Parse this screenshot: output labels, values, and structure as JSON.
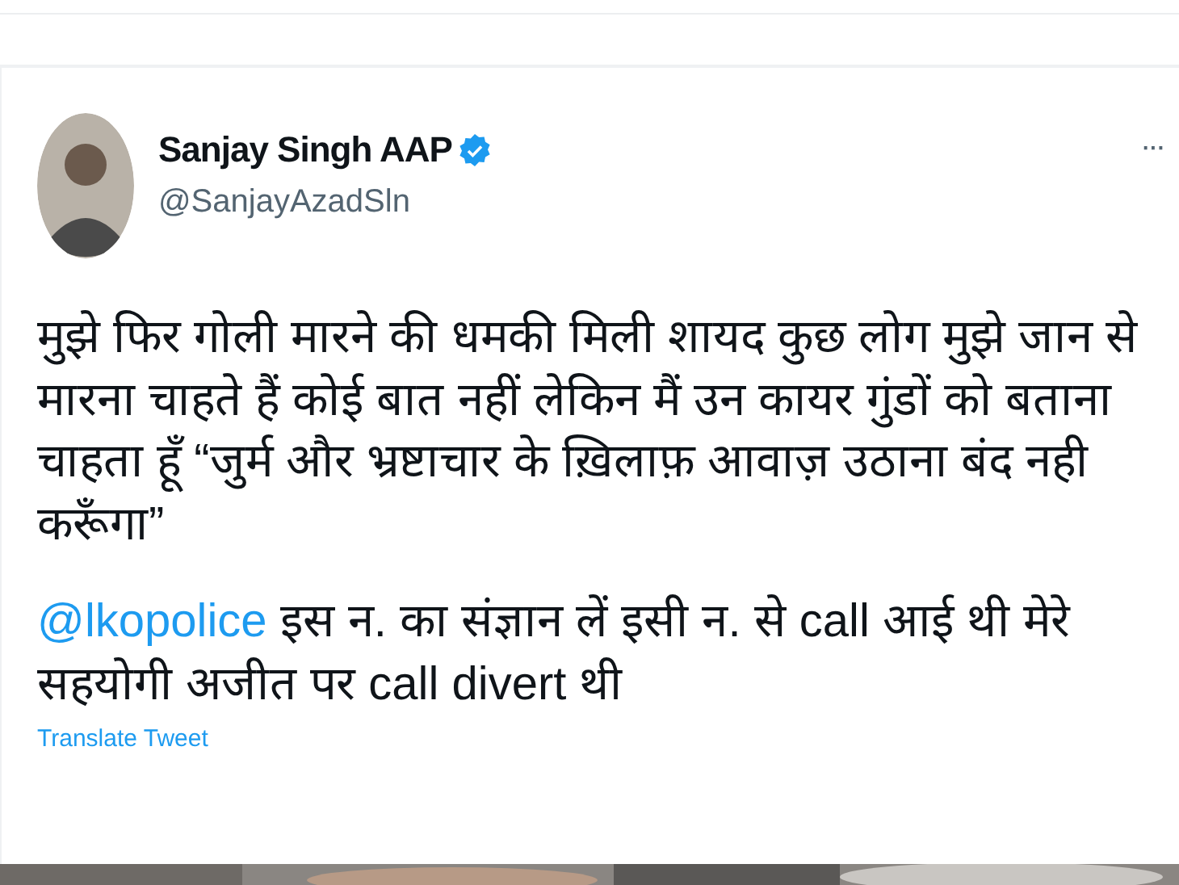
{
  "tweet": {
    "author": {
      "name": "Sanjay Singh AAP",
      "verified": true,
      "handle": "@SanjayAzadSln"
    },
    "more": "···",
    "text": "मुझे फिर गोली मारने की धमकी मिली शायद कुछ लोग मुझे जान से मारना चाहते हैं कोई बात नहीं लेकिन मैं उन कायर गुंडों को बताना चाहता हूँ “जुर्म और भ्रष्टाचार के ख़िलाफ़ आवाज़ उठाना बंद नही करूँगा”",
    "reply": {
      "mention": "@lkopolice",
      "text": " इस न. का संज्ञान लें इसी न. से call आई थी मेरे सहयोगी अजीत पर call divert थी"
    },
    "translate": "Translate Tweet"
  }
}
